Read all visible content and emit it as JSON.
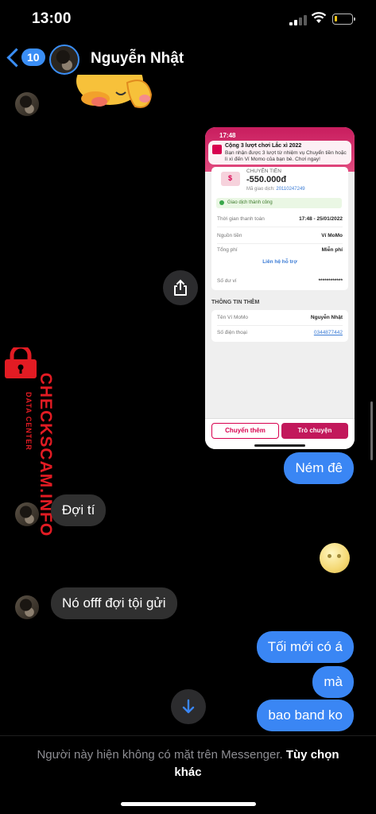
{
  "status_bar": {
    "time": "13:00"
  },
  "header": {
    "back_count": "10",
    "contact_name": "Nguyễn Nhật"
  },
  "shared_screenshot": {
    "time": "17:48",
    "notification_title": "Cộng 3 lượt chơi Lắc xì 2022",
    "notification_body": "Bạn nhận được 3 lượt từ nhiệm vụ Chuyển tiền hoặc lì xì đến Ví Momo của bạn bè. Chơi ngay!",
    "tx_type": "CHUYỂN TIỀN",
    "amount": "-550.000đ",
    "tx_code_label": "Mã giao dịch:",
    "tx_code": "20110247249",
    "status": "Giao dịch thành công",
    "rows": [
      {
        "label": "Thời gian thanh toán",
        "value": "17:48 - 25/01/2022"
      },
      {
        "label": "Nguồn tiền",
        "value": "Ví MoMo"
      },
      {
        "label": "Tổng phí",
        "value": "Miễn phí"
      }
    ],
    "support": "Liên hệ hỗ trợ",
    "balance_label": "Số dư ví",
    "balance_value": "************",
    "info_title": "THÔNG TIN THÊM",
    "info_rows": [
      {
        "label": "Tên Ví MoMo",
        "value": "Nguyễn Nhật"
      },
      {
        "label": "Số điện thoại",
        "value": "0344877442"
      }
    ],
    "btn_more": "Chuyển thêm",
    "btn_chat": "Trò chuyện"
  },
  "watermark": {
    "main": "CHECKSCAM.INFO",
    "sub": "DATA CENTER"
  },
  "messages": [
    {
      "dir": "out",
      "text": "Ném đê"
    },
    {
      "dir": "in",
      "text": "Đợi tí"
    },
    {
      "dir": "in",
      "text": "Nó offf đợi tội gửi"
    },
    {
      "dir": "out",
      "text": "Tối mới có á"
    },
    {
      "dir": "out",
      "text": "mà"
    },
    {
      "dir": "out",
      "text": "bao band ko"
    }
  ],
  "footer": {
    "notice": "Người này hiện không có mặt trên Messenger.",
    "options": "Tùy chọn khác"
  },
  "colors": {
    "accent": "#3a86f4",
    "incoming_bubble": "#303030",
    "watermark": "#e21b23",
    "momo": "#c2185b"
  }
}
